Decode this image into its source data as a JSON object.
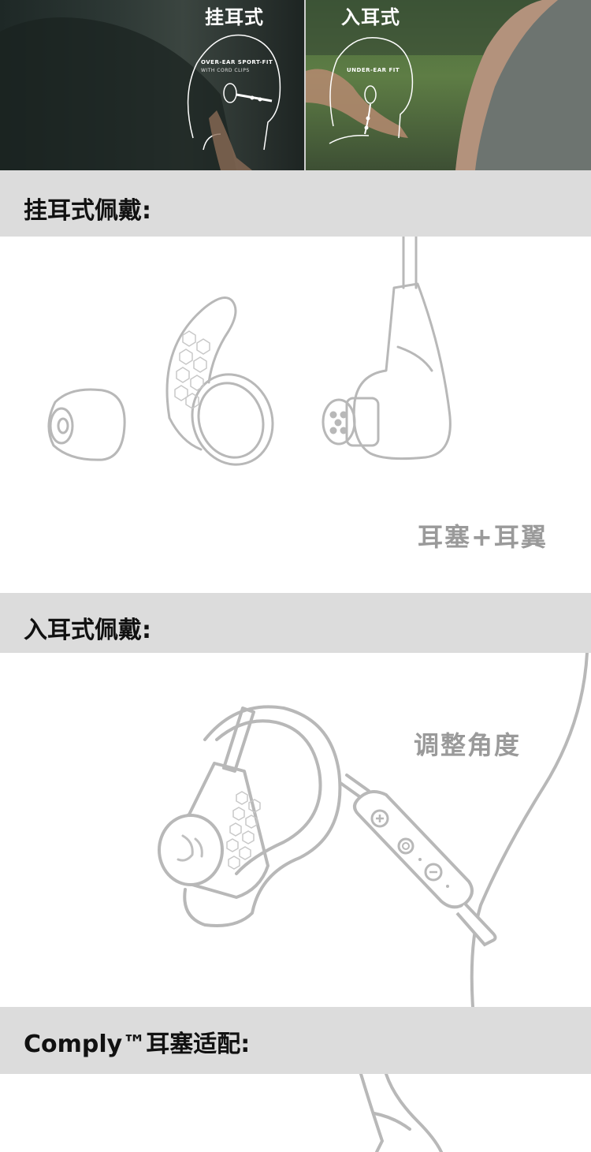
{
  "hero": {
    "left_title": "挂耳式",
    "left_badge": "OVER-EAR SPORT-FIT",
    "left_badge_sub": "WITH CORD CLIPS",
    "right_title": "入耳式",
    "right_badge": "UNDER-EAR FIT"
  },
  "sections": [
    {
      "title": "挂耳式佩戴:",
      "caption": "耳塞+耳翼"
    },
    {
      "title": "入耳式佩戴:",
      "caption": "调整角度"
    },
    {
      "title": "Comply™耳塞适配:"
    }
  ],
  "colors": {
    "band": "#dcdcdc",
    "caption": "#9a9a9a",
    "line_art": "#b8b8b8"
  }
}
